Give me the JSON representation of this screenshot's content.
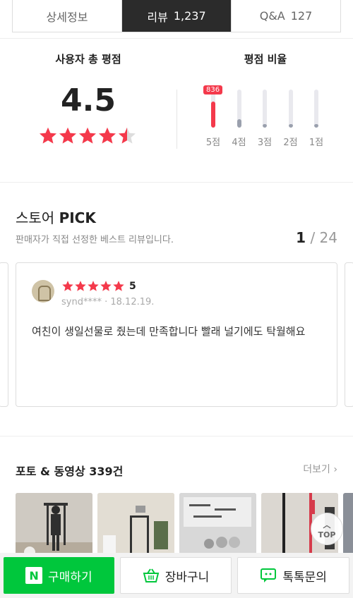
{
  "tabs": [
    {
      "label": "상세정보",
      "count": ""
    },
    {
      "label": "리뷰",
      "count": "1,237"
    },
    {
      "label": "Q&A",
      "count": "127"
    }
  ],
  "rating": {
    "title": "사용자 총 평점",
    "score": "4.5",
    "stars_value": 4.5,
    "ratio_title": "평점 비율",
    "bars": [
      {
        "label": "5점",
        "badge": "836",
        "fraction": 0.68
      },
      {
        "label": "4점",
        "badge": "",
        "fraction": 0.22
      },
      {
        "label": "3점",
        "badge": "",
        "fraction": 0.1
      },
      {
        "label": "2점",
        "badge": "",
        "fraction": 0.1
      },
      {
        "label": "1점",
        "badge": "",
        "fraction": 0.1
      }
    ]
  },
  "pick": {
    "title_prefix": "스토어 ",
    "title_bold": "PICK",
    "subtitle": "판매자가 직접 선정한 베스트 리뷰입니다.",
    "page_current": "1",
    "page_sep": " / ",
    "page_total": "24",
    "review": {
      "score": "5",
      "user": "synd****",
      "date": "18.12.19.",
      "meta_sep": " · ",
      "text": "여친이 생일선물로 줬는데 만족합니다 빨래 널기에도 탁월해요"
    }
  },
  "photos": {
    "title": "포토 & 동영상 339건",
    "more": "더보기",
    "top_label": "TOP"
  },
  "bottom": {
    "buy": "구매하기",
    "cart": "장바구니",
    "talk": "톡톡문의",
    "n_logo": "N"
  },
  "colors": {
    "star": "#f4394b",
    "buy_green": "#00c73c"
  }
}
